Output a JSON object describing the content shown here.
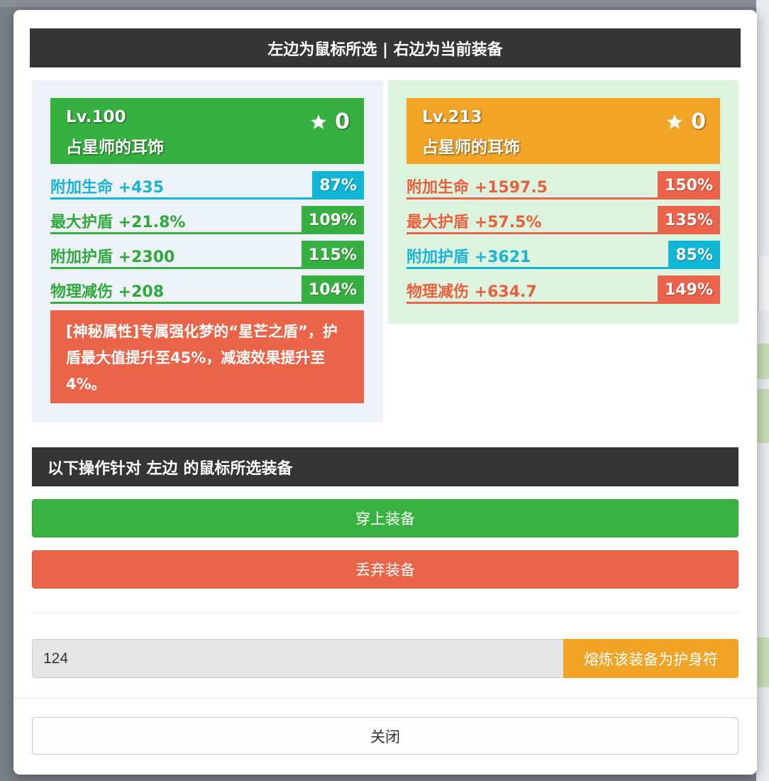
{
  "modal": {
    "title": "左边为鼠标所选 | 右边为当前装备",
    "ops_title": "以下操作针对 左边 的鼠标所选装备",
    "equip_button": "穿上装备",
    "discard_button": "丢弃装备",
    "smelt_input_value": "124",
    "smelt_button": "熔炼该装备为护身符",
    "close_button": "关闭"
  },
  "left_item": {
    "level": "Lv.100",
    "name": "占星师的耳饰",
    "stars": "0",
    "color": "#36b040",
    "stats": [
      {
        "label": "附加生命 +435",
        "pct": "87%",
        "color": "cyan"
      },
      {
        "label": "最大护盾 +21.8%",
        "pct": "109%",
        "color": "green"
      },
      {
        "label": "附加护盾 +2300",
        "pct": "115%",
        "color": "green"
      },
      {
        "label": "物理减伤 +208",
        "pct": "104%",
        "color": "green"
      }
    ],
    "mystery": "[神秘属性]专属强化梦的“星芒之盾”，护盾最大值提升至45%，减速效果提升至4%。"
  },
  "right_item": {
    "level": "Lv.213",
    "name": "占星师的耳饰",
    "stars": "0",
    "color": "#f1a426",
    "stats": [
      {
        "label": "附加生命 +1597.5",
        "pct": "150%",
        "color": "red"
      },
      {
        "label": "最大护盾 +57.5%",
        "pct": "135%",
        "color": "red"
      },
      {
        "label": "附加护盾 +3621",
        "pct": "85%",
        "color": "cyan"
      },
      {
        "label": "物理减伤 +634.7",
        "pct": "149%",
        "color": "red"
      }
    ]
  },
  "colors": {
    "cyan": "#10b6d6",
    "green": "#36b040",
    "red": "#ea634a",
    "orange": "#f1a426",
    "dark": "#353535"
  }
}
